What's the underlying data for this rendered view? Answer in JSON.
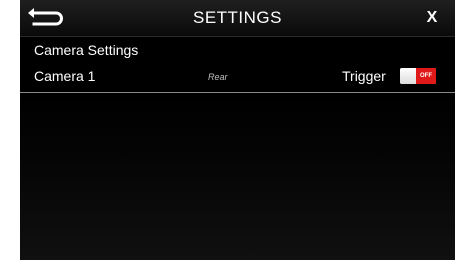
{
  "header": {
    "title": "SETTINGS",
    "close_label": "X",
    "back_icon": "back-arrow-icon"
  },
  "section": {
    "title": "Camera Settings"
  },
  "camera_row": {
    "name": "Camera 1",
    "position": "Rear",
    "trigger_label": "Trigger",
    "toggle_state": "OFF",
    "toggle_color": "#e01818"
  }
}
